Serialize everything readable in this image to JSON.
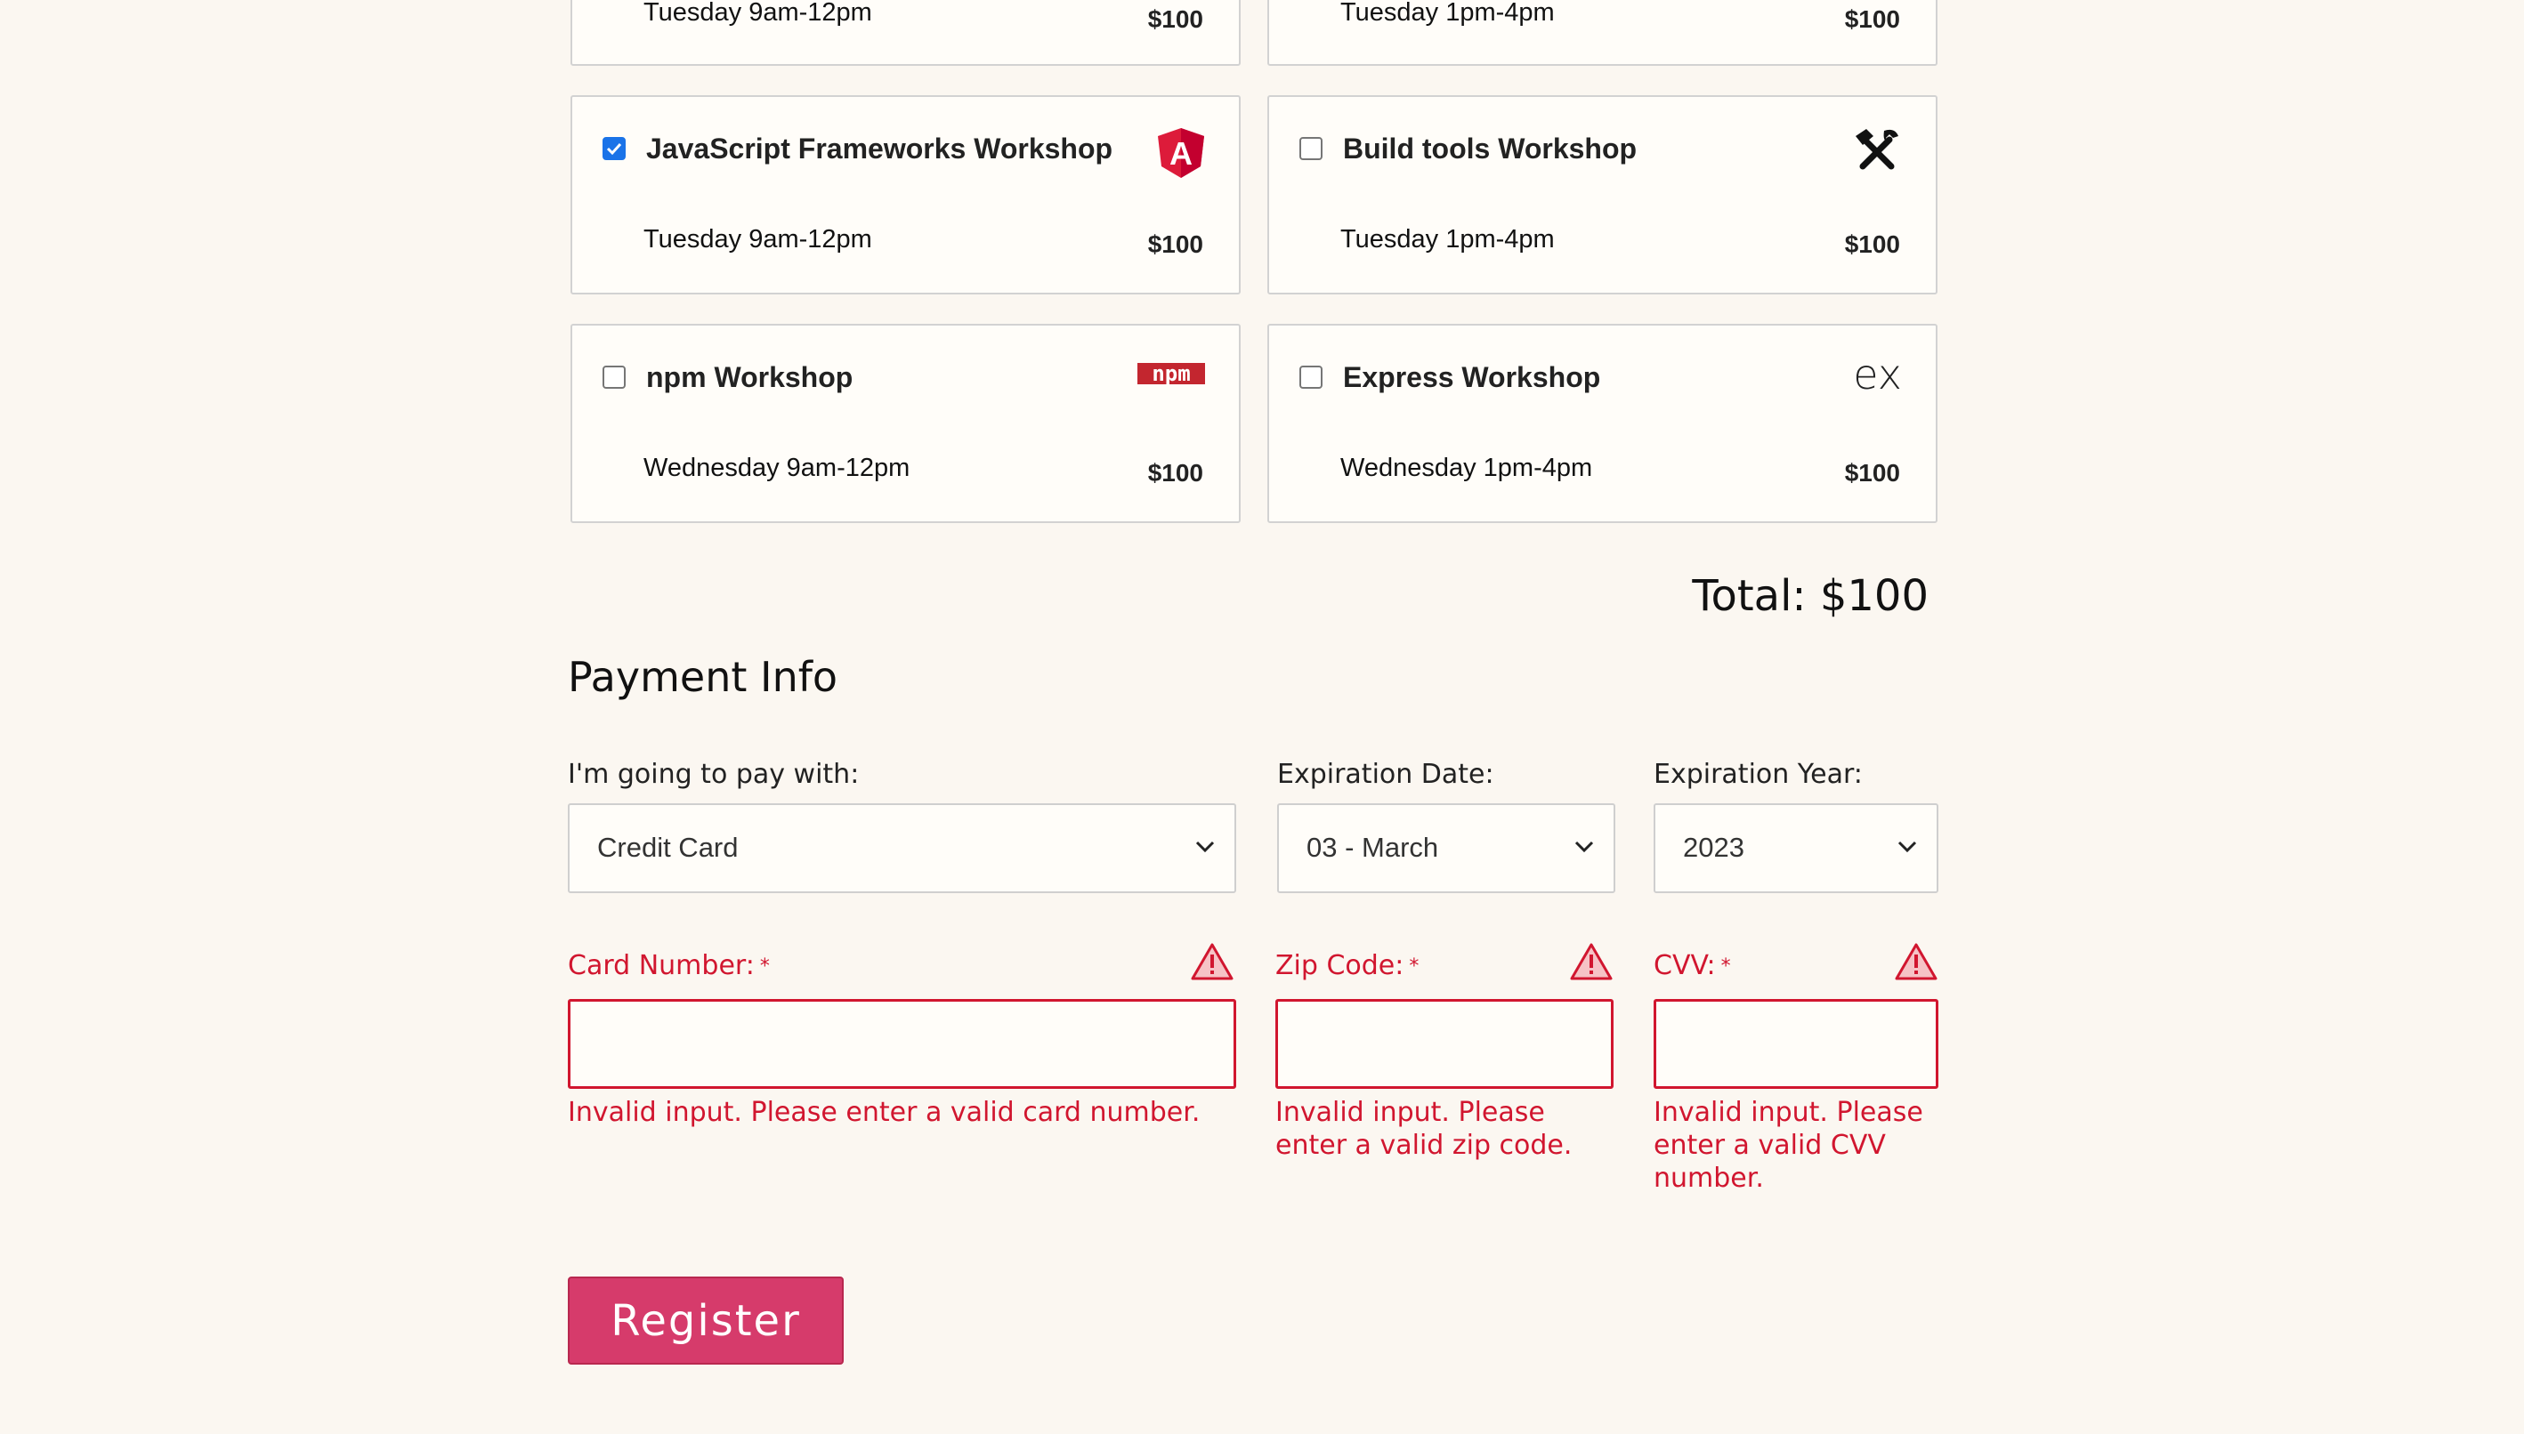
{
  "workshops": [
    {
      "title": "",
      "time": "Tuesday 9am-12pm",
      "price": "$100",
      "checked": false
    },
    {
      "title": "",
      "time": "Tuesday 1pm-4pm",
      "price": "$100",
      "checked": false
    },
    {
      "title": "JavaScript Frameworks Workshop",
      "time": "Tuesday 9am-12pm",
      "price": "$100",
      "checked": true,
      "icon": "angular-icon",
      "icon_text": "A"
    },
    {
      "title": "Build tools Workshop",
      "time": "Tuesday 1pm-4pm",
      "price": "$100",
      "checked": false,
      "icon": "hammer-wrench-icon"
    },
    {
      "title": "npm Workshop",
      "time": "Wednesday 9am-12pm",
      "price": "$100",
      "checked": false,
      "icon": "npm-icon",
      "icon_text": "npm"
    },
    {
      "title": "Express Workshop",
      "time": "Wednesday 1pm-4pm",
      "price": "$100",
      "checked": false,
      "icon": "express-icon",
      "icon_text": "ex"
    }
  ],
  "total": "Total: $100",
  "payment": {
    "heading": "Payment Info",
    "pay_with_label": "I'm going to pay with:",
    "pay_with_value": "Credit Card",
    "exp_date_label": "Expiration Date:",
    "exp_date_value": "03 - March",
    "exp_year_label": "Expiration Year:",
    "exp_year_value": "2023",
    "card_label": "Card Number:",
    "zip_label": "Zip Code:",
    "cvv_label": "CVV:",
    "required_mark": "*",
    "card_error": "Invalid input. Please enter a valid card number.",
    "zip_error": "Invalid input. Please enter a valid zip code.",
    "cvv_error": "Invalid input. Please enter a valid CVV number."
  },
  "register_label": "Register",
  "colors": {
    "background": "#fbf7f1",
    "error": "#d1162f",
    "accent": "#d63b6b",
    "checkbox": "#1a73e8"
  }
}
